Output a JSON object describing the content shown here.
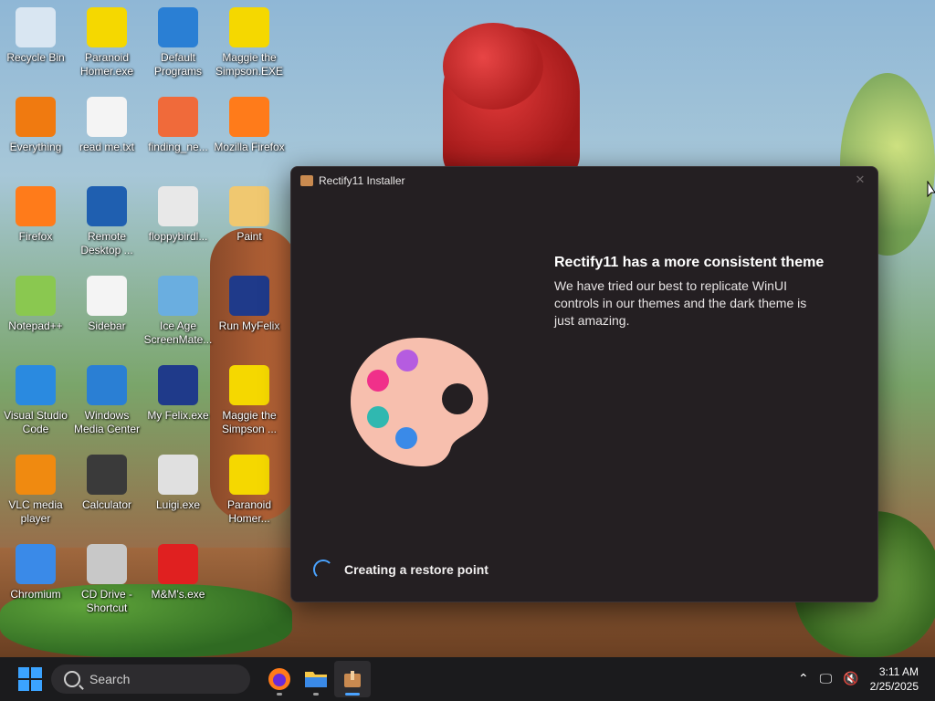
{
  "desktop": {
    "icons": [
      {
        "label": "Recycle Bin",
        "icon": "recycle-bin-icon",
        "color": "#d9e6f2"
      },
      {
        "label": "Paranoid Homer.exe",
        "icon": "homer-icon",
        "color": "#f5d800"
      },
      {
        "label": "Default Programs",
        "icon": "default-programs-icon",
        "color": "#2a7fd4"
      },
      {
        "label": "Maggie the Simpson.EXE",
        "icon": "maggie-icon",
        "color": "#f5d800"
      },
      {
        "label": "Everything",
        "icon": "everything-icon",
        "color": "#f07a10"
      },
      {
        "label": "read me.txt",
        "icon": "text-file-icon",
        "color": "#f4f4f4"
      },
      {
        "label": "finding_ne...",
        "icon": "nemo-icon",
        "color": "#f06a3a"
      },
      {
        "label": "Mozilla Firefox",
        "icon": "firefox-icon",
        "color": "#ff7b1a"
      },
      {
        "label": "Firefox",
        "icon": "firefox-icon",
        "color": "#ff7b1a"
      },
      {
        "label": "Remote Desktop ...",
        "icon": "remote-desktop-icon",
        "color": "#1f5fb0"
      },
      {
        "label": "floppybirdl...",
        "icon": "floppy-file-icon",
        "color": "#e8e8e8"
      },
      {
        "label": "Paint",
        "icon": "paint-icon",
        "color": "#f0c870"
      },
      {
        "label": "Notepad++",
        "icon": "notepadpp-icon",
        "color": "#8ac850"
      },
      {
        "label": "Sidebar",
        "icon": "file-icon",
        "color": "#f4f4f4"
      },
      {
        "label": "Ice Age ScreenMate...",
        "icon": "ice-age-icon",
        "color": "#6aaee0"
      },
      {
        "label": "Run MyFelix",
        "icon": "felix-icon",
        "color": "#1f3a8a"
      },
      {
        "label": "Visual Studio Code",
        "icon": "vscode-icon",
        "color": "#2a8ae0"
      },
      {
        "label": "Windows Media Center",
        "icon": "media-center-icon",
        "color": "#2a7fd4"
      },
      {
        "label": "My Felix.exe",
        "icon": "felix-icon",
        "color": "#1f3a8a"
      },
      {
        "label": "Maggie the Simpson ...",
        "icon": "maggie-icon",
        "color": "#f5d800"
      },
      {
        "label": "VLC media player",
        "icon": "vlc-icon",
        "color": "#f08a10"
      },
      {
        "label": "Calculator",
        "icon": "calculator-icon",
        "color": "#3a3a3a"
      },
      {
        "label": "Luigi.exe",
        "icon": "luigi-icon",
        "color": "#e0e0e0"
      },
      {
        "label": "Paranoid Homer...",
        "icon": "homer-icon",
        "color": "#f5d800"
      },
      {
        "label": "Chromium",
        "icon": "chromium-icon",
        "color": "#3a8ae8"
      },
      {
        "label": "CD Drive - Shortcut",
        "icon": "cd-drive-icon",
        "color": "#c8c8c8"
      },
      {
        "label": "M&M's.exe",
        "icon": "mm-icon",
        "color": "#e02020"
      }
    ]
  },
  "installer": {
    "title": "Rectify11 Installer",
    "close_label": "✕",
    "heading": "Rectify11 has a more consistent theme",
    "description": "We have tried our best to replicate WinUI controls in our themes and the dark theme is just amazing.",
    "status": "Creating a restore point",
    "accent": "#4aa3ff"
  },
  "taskbar": {
    "search_placeholder": "Search",
    "apps": [
      {
        "name": "firefox",
        "icon": "firefox-icon"
      },
      {
        "name": "file-explorer",
        "icon": "folder-icon"
      },
      {
        "name": "installer",
        "icon": "installer-icon",
        "active": true
      }
    ],
    "time": "3:11 AM",
    "date": "2/25/2025"
  }
}
